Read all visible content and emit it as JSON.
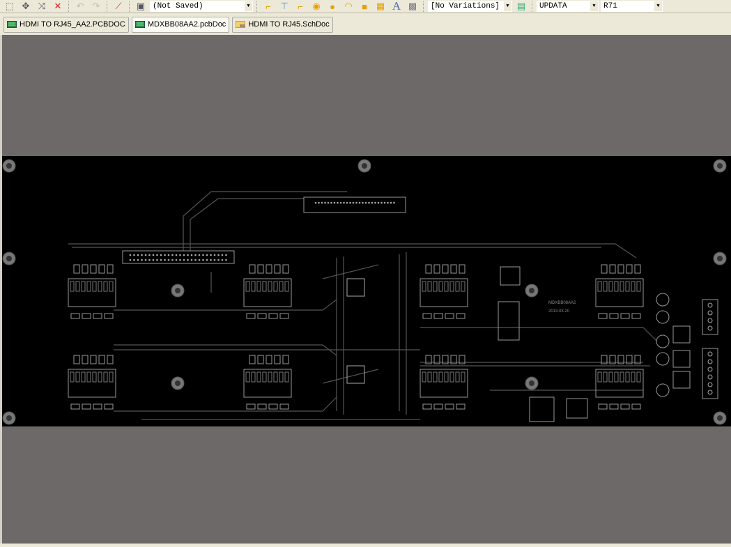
{
  "toolbar": {
    "icons": [
      "select-rect-icon",
      "move-icon",
      "select-connected-icon",
      "clear-filter-icon",
      "undo-icon",
      "redo-icon",
      "wand-icon",
      "browse-icon"
    ],
    "filter_combo": "(Not Saved)",
    "place_icons": [
      "route-icon",
      "route-diff-icon",
      "multi-route-icon",
      "via-icon",
      "pad-icon",
      "arc-icon",
      "fill-icon",
      "polygon-icon",
      "string-icon",
      "component-icon"
    ],
    "variations_combo": "[No Variations]",
    "net_combo": "UPDATA",
    "component_combo": "R71"
  },
  "tabs": [
    {
      "label": "HDMI TO RJ45_AA2.PCBDOC",
      "icon": "pcb-doc-icon",
      "active": false
    },
    {
      "label": "MDXBB08AA2.pcbDoc",
      "icon": "pcb-doc-icon",
      "active": true
    },
    {
      "label": "HDMI TO RJ45.SchDoc",
      "icon": "sch-doc-icon",
      "active": false
    }
  ],
  "board": {
    "name": "MDXBB08AA2",
    "date": "2013.03.20"
  },
  "colors": {
    "canvas": "#6d6968",
    "board": "#000000",
    "silk": "#8c8c8c"
  }
}
